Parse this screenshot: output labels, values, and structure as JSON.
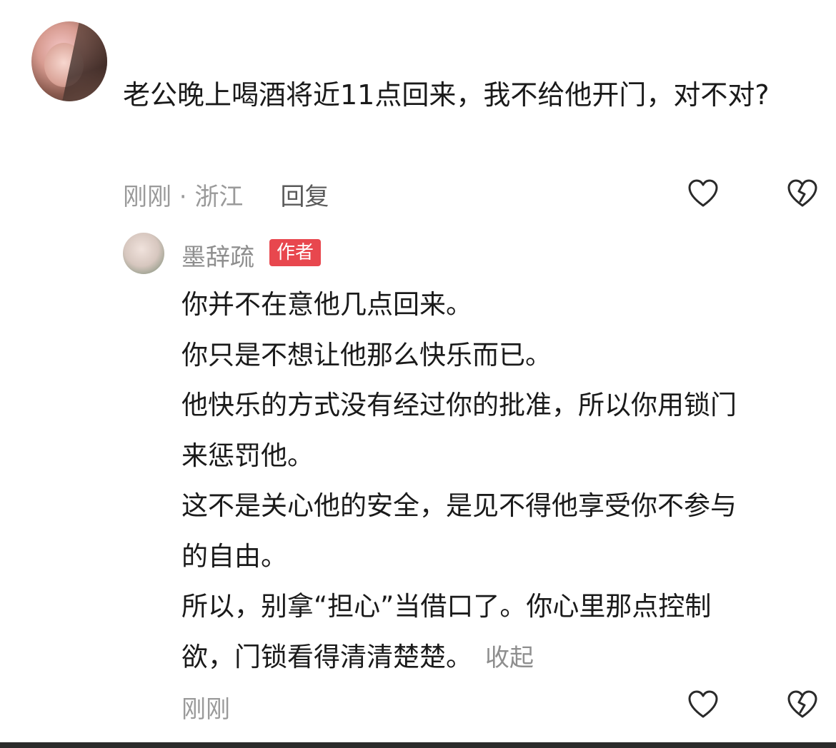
{
  "top_comment": {
    "text": "老公晚上喝酒将近11点回来，我不给他开门，对不对?",
    "time": "刚刚",
    "separator": " · ",
    "location": "浙江",
    "reply_label": "回复"
  },
  "author_reply": {
    "name": "墨辞疏",
    "badge": "作者",
    "lines": [
      "你并不在意他几点回来。",
      "你只是不想让他那么快乐而已。",
      "他快乐的方式没有经过你的批准，所以你用锁门",
      "来惩罚他。",
      "这不是关心他的安全，是见不得他享受你不参与",
      "的自由。",
      "所以，别拿“担心”当借口了。你心里那点控制",
      "欲，门锁看得清清楚楚。"
    ],
    "collapse_label": "收起",
    "time": "刚刚"
  },
  "icons": {
    "like": "heart-outline-icon",
    "dislike": "broken-heart-icon"
  },
  "colors": {
    "badge_bg": "#e8474e",
    "meta_text": "#9a9a9a",
    "body_text": "#1a1a1a"
  }
}
